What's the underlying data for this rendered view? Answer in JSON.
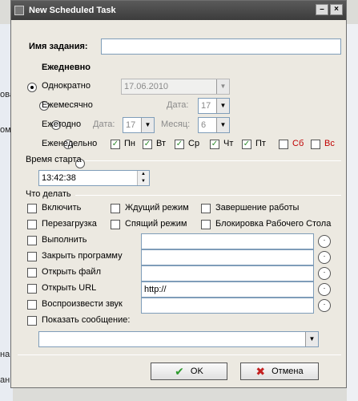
{
  "window": {
    "title": "New Scheduled Task"
  },
  "name_label": "Имя задания:",
  "name_value": "",
  "schedule": {
    "daily": "Ежедневно",
    "once": "Однократно",
    "once_date": "17.06.2010",
    "monthly": "Ежемесячно",
    "date_label": "Дата:",
    "monthly_day": "17",
    "yearly": "Ежегодно",
    "yearly_day": "17",
    "month_label": "Месяц:",
    "yearly_month": "6",
    "weekly": "Еженедельно",
    "days": [
      {
        "label": "Пн",
        "checked": true
      },
      {
        "label": "Вт",
        "checked": true
      },
      {
        "label": "Ср",
        "checked": true
      },
      {
        "label": "Чт",
        "checked": true
      },
      {
        "label": "Пт",
        "checked": true
      },
      {
        "label": "Сб",
        "checked": false
      },
      {
        "label": "Вс",
        "checked": false
      }
    ]
  },
  "start_time": {
    "label": "Время старта",
    "value": "13:42:38"
  },
  "actions": {
    "label": "Что делать",
    "turn_on": "Включить",
    "standby": "Ждущий режим",
    "shutdown": "Завершение работы",
    "reboot": "Перезагрузка",
    "sleep": "Спящий режим",
    "lock": "Блокировка Рабочего Стола",
    "run": "Выполнить",
    "close_program": "Закрыть программу",
    "open_file": "Открыть файл",
    "open_url": "Открыть URL",
    "url_value": "http://",
    "play_sound": "Воспроизвести звук",
    "show_message": "Показать сообщение:"
  },
  "buttons": {
    "ok": "OK",
    "cancel": "Отмена"
  },
  "background": {
    "left_texts": [
      "ова",
      "оме",
      "на",
      "ан"
    ]
  }
}
